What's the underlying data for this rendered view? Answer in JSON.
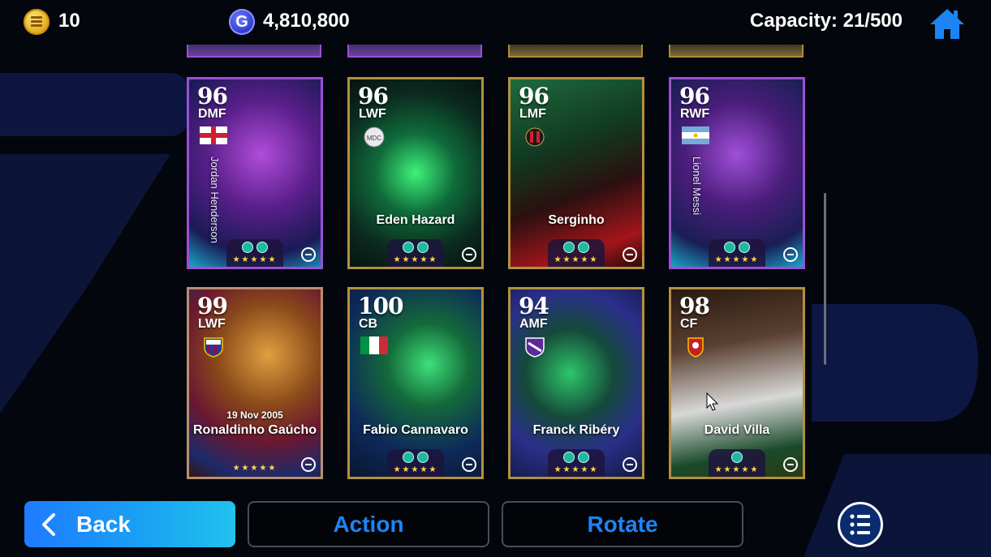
{
  "header": {
    "coins_value": "10",
    "gp_symbol": "G",
    "gp_value": "4,810,800",
    "capacity_text": "Capacity: 21/500"
  },
  "cards": [
    {
      "rating": "96",
      "position": "DMF",
      "name": "Jordan Henderson",
      "name_style": "vertical",
      "date": "",
      "stars": "★★★★★"
    },
    {
      "rating": "96",
      "position": "LWF",
      "name": "Eden Hazard",
      "name_style": "horizontal",
      "date": "",
      "stars": "★★★★★"
    },
    {
      "rating": "96",
      "position": "LMF",
      "name": "Serginho",
      "name_style": "horizontal",
      "date": "",
      "stars": "★★★★★"
    },
    {
      "rating": "96",
      "position": "RWF",
      "name": "Lionel Messi",
      "name_style": "vertical",
      "date": "",
      "stars": "★★★★★"
    },
    {
      "rating": "99",
      "position": "LWF",
      "name": "Ronaldinho Gaúcho",
      "name_style": "horizontal",
      "date": "19 Nov 2005",
      "stars": "★★★★★"
    },
    {
      "rating": "100",
      "position": "CB",
      "name": "Fabio Cannavaro",
      "name_style": "horizontal",
      "date": "",
      "stars": "★★★★★"
    },
    {
      "rating": "94",
      "position": "AMF",
      "name": "Franck Ribéry",
      "name_style": "horizontal",
      "date": "",
      "stars": "★★★★★"
    },
    {
      "rating": "98",
      "position": "CF",
      "name": "David Villa",
      "name_style": "horizontal",
      "date": "",
      "stars": "★★★★★"
    }
  ],
  "buttons": {
    "back_label": "Back",
    "action_label": "Action",
    "rotate_label": "Rotate"
  },
  "colors": {
    "accent_blue": "#1d84f5",
    "card_gold": "#b1913f",
    "card_purple": "#9b4fd6",
    "star_yellow": "#ffd84a"
  },
  "icons": {
    "coin": "coin-icon",
    "gp": "gp-coin-icon",
    "home": "home-icon",
    "back": "chevron-left-icon",
    "menu": "list-menu-icon"
  }
}
